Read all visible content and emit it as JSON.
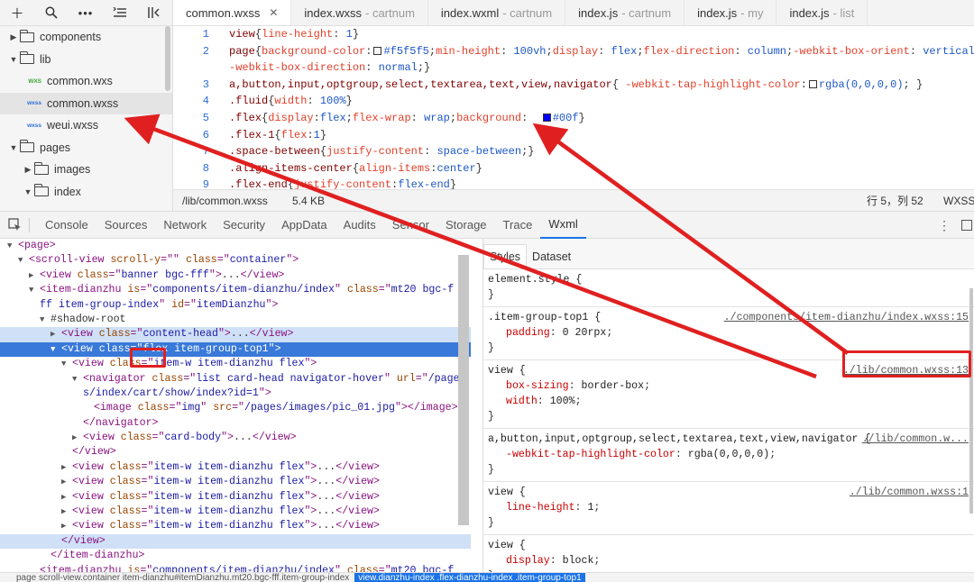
{
  "toolbar": {
    "buttons": [
      "plus-icon",
      "search-icon",
      "more-icon",
      "collapse-icon",
      "split-icon"
    ]
  },
  "sidebar": {
    "items": [
      {
        "label": "components",
        "type": "folder",
        "open": false,
        "indent": 0
      },
      {
        "label": "lib",
        "type": "folder",
        "open": true,
        "indent": 0
      },
      {
        "label": "common.wxs",
        "type": "wxs",
        "indent": 1,
        "badge": "WXS"
      },
      {
        "label": "common.wxss",
        "type": "wxss",
        "indent": 1,
        "badge": "wxss",
        "selected": true
      },
      {
        "label": "weui.wxss",
        "type": "wxss",
        "indent": 1,
        "badge": "wxss"
      },
      {
        "label": "pages",
        "type": "folder",
        "open": true,
        "indent": 0
      },
      {
        "label": "images",
        "type": "folder",
        "open": false,
        "indent": 1
      },
      {
        "label": "index",
        "type": "folder",
        "open": true,
        "indent": 1
      }
    ]
  },
  "editor": {
    "tabs": [
      {
        "name": "common.wxss",
        "dim": "",
        "active": true,
        "close": "✕"
      },
      {
        "name": "index.wxss",
        "dim": "- cartnum"
      },
      {
        "name": "index.wxml",
        "dim": "- cartnum"
      },
      {
        "name": "index.js",
        "dim": "- cartnum"
      },
      {
        "name": "index.js",
        "dim": "- my"
      },
      {
        "name": "index.js",
        "dim": "- list"
      }
    ],
    "lines": [
      {
        "n": "1",
        "t": [
          [
            "sel-c",
            "view"
          ],
          [
            "pun",
            "{"
          ],
          [
            "prop",
            "line-height"
          ],
          [
            "pun",
            ": "
          ],
          [
            "val",
            "1"
          ],
          [
            "pun",
            "}"
          ]
        ]
      },
      {
        "n": "2",
        "t": [
          [
            "sel-c",
            "page"
          ],
          [
            "pun",
            "{"
          ],
          [
            "prop",
            "background-color"
          ],
          [
            "pun",
            ":"
          ],
          [
            "sw",
            "#f5f5f5"
          ],
          [
            "val",
            "#f5f5f5"
          ],
          [
            "pun",
            ";"
          ],
          [
            "prop",
            "min-height"
          ],
          [
            "pun",
            ": "
          ],
          [
            "val",
            "100vh"
          ],
          [
            "pun",
            ";"
          ],
          [
            "prop",
            "display"
          ],
          [
            "pun",
            ": "
          ],
          [
            "val",
            "flex"
          ],
          [
            "pun",
            ";"
          ],
          [
            "prop",
            "flex-direction"
          ],
          [
            "pun",
            ": "
          ],
          [
            "val",
            "column"
          ],
          [
            "pun",
            ";"
          ],
          [
            "prop",
            "-webkit-box-orient"
          ],
          [
            "pun",
            ": "
          ],
          [
            "val",
            "vertical"
          ],
          [
            "pun",
            ";"
          ]
        ]
      },
      {
        "n": "",
        "t": [
          [
            "prop",
            "-webkit-box-direction"
          ],
          [
            "pun",
            ": "
          ],
          [
            "val",
            "normal"
          ],
          [
            "pun",
            ";}"
          ]
        ]
      },
      {
        "n": "3",
        "t": [
          [
            "sel-c",
            "a,button,input,optgroup,select,textarea,text,view,navigator"
          ],
          [
            "pun",
            "{ "
          ],
          [
            "prop",
            "-webkit-tap-highlight-color"
          ],
          [
            "pun",
            ":"
          ],
          [
            "sw",
            "#ffffff"
          ],
          [
            "val",
            "rgba(0,0,0,0)"
          ],
          [
            "pun",
            "; }"
          ]
        ]
      },
      {
        "n": "4",
        "t": [
          [
            "sel-c",
            ".fluid"
          ],
          [
            "pun",
            "{"
          ],
          [
            "prop",
            "width"
          ],
          [
            "pun",
            ": "
          ],
          [
            "val",
            "100%"
          ],
          [
            "pun",
            "}"
          ]
        ]
      },
      {
        "n": "5",
        "t": [
          [
            "sel-c",
            ".flex"
          ],
          [
            "pun",
            "{"
          ],
          [
            "prop",
            "display"
          ],
          [
            "pun",
            ":"
          ],
          [
            "val",
            "flex"
          ],
          [
            "pun",
            ";"
          ],
          [
            "prop",
            "flex-wrap"
          ],
          [
            "pun",
            ": "
          ],
          [
            "val",
            "wrap"
          ],
          [
            "pun",
            ";"
          ],
          [
            "prop",
            "background"
          ],
          [
            "pun",
            ":  "
          ],
          [
            "sw",
            "#0000ff"
          ],
          [
            "val",
            "#00f"
          ],
          [
            "pun",
            "}"
          ]
        ]
      },
      {
        "n": "6",
        "t": [
          [
            "sel-c",
            ".flex-1"
          ],
          [
            "pun",
            "{"
          ],
          [
            "prop",
            "flex"
          ],
          [
            "pun",
            ":"
          ],
          [
            "val",
            "1"
          ],
          [
            "pun",
            "}"
          ]
        ]
      },
      {
        "n": "7",
        "t": [
          [
            "sel-c",
            ".space-between"
          ],
          [
            "pun",
            "{"
          ],
          [
            "prop",
            "justify-content"
          ],
          [
            "pun",
            ": "
          ],
          [
            "val",
            "space-between"
          ],
          [
            "pun",
            ";}"
          ]
        ]
      },
      {
        "n": "8",
        "t": [
          [
            "sel-c",
            ".align-items-center"
          ],
          [
            "pun",
            "{"
          ],
          [
            "prop",
            "align-items"
          ],
          [
            "pun",
            ":"
          ],
          [
            "val",
            "center"
          ],
          [
            "pun",
            "}"
          ]
        ]
      },
      {
        "n": "9",
        "t": [
          [
            "sel-c",
            ".flex-end"
          ],
          [
            "pun",
            "{"
          ],
          [
            "prop",
            "justify-content"
          ],
          [
            "pun",
            ":"
          ],
          [
            "val",
            "flex-end"
          ],
          [
            "pun",
            "}"
          ]
        ]
      }
    ],
    "status": {
      "path": "/lib/common.wxss",
      "size": "5.4 KB",
      "cursor": "行 5，列 52",
      "lang": "WXSS"
    }
  },
  "devtools": {
    "tabs": [
      "Console",
      "Sources",
      "Network",
      "Security",
      "AppData",
      "Audits",
      "Sensor",
      "Storage",
      "Trace",
      "Wxml"
    ],
    "active": "Wxml"
  },
  "elements": [
    {
      "ind": 0,
      "tri": "▼",
      "p": [
        [
          "t",
          "<page>"
        ]
      ]
    },
    {
      "ind": 1,
      "tri": "▼",
      "p": [
        [
          "t",
          "<scroll-view "
        ],
        [
          "a",
          "scroll-y"
        ],
        [
          "t",
          "=\""
        ],
        [
          "v",
          ""
        ],
        [
          "t",
          "\" "
        ],
        [
          "a",
          "class"
        ],
        [
          "t",
          "=\""
        ],
        [
          "v",
          "container"
        ],
        [
          "t",
          "\">"
        ]
      ]
    },
    {
      "ind": 2,
      "tri": "▶",
      "p": [
        [
          "t",
          "<view "
        ],
        [
          "a",
          "class"
        ],
        [
          "t",
          "=\""
        ],
        [
          "v",
          "banner bgc-fff"
        ],
        [
          "t",
          "\">"
        ],
        [
          "x",
          "..."
        ],
        [
          "t",
          "</view>"
        ]
      ]
    },
    {
      "ind": 2,
      "tri": "▼",
      "p": [
        [
          "t",
          "<item-dianzhu "
        ],
        [
          "a",
          "is"
        ],
        [
          "t",
          "=\""
        ],
        [
          "v",
          "components/item-dianzhu/index"
        ],
        [
          "t",
          "\" "
        ],
        [
          "a",
          "class"
        ],
        [
          "t",
          "=\""
        ],
        [
          "v",
          "mt20 bgc-f"
        ]
      ]
    },
    {
      "ind": 2,
      "tri": "",
      "p": [
        [
          "v",
          "ff item-group-index"
        ],
        [
          "t",
          "\" "
        ],
        [
          "a",
          "id"
        ],
        [
          "t",
          "=\""
        ],
        [
          "v",
          "itemDianzhu"
        ],
        [
          "t",
          "\">"
        ]
      ]
    },
    {
      "ind": 3,
      "tri": "▼",
      "p": [
        [
          "x",
          "#shadow-root"
        ]
      ]
    },
    {
      "ind": 4,
      "tri": "▶",
      "p": [
        [
          "t",
          "<view "
        ],
        [
          "a",
          "class"
        ],
        [
          "t",
          "=\""
        ],
        [
          "v",
          "content-head"
        ],
        [
          "t",
          "\">"
        ],
        [
          "x",
          "..."
        ],
        [
          "t",
          "</view>"
        ]
      ],
      "sel": true
    },
    {
      "ind": 4,
      "tri": "▼",
      "p": [
        [
          "t",
          "<view "
        ],
        [
          "a",
          "class"
        ],
        [
          "t",
          "=\""
        ],
        [
          "v",
          "flex item-group-top1"
        ],
        [
          "t",
          "\">"
        ]
      ],
      "hl": true
    },
    {
      "ind": 5,
      "tri": "▼",
      "p": [
        [
          "t",
          "<view "
        ],
        [
          "a",
          "class"
        ],
        [
          "t",
          "=\""
        ],
        [
          "v",
          "item-w item-dianzhu flex"
        ],
        [
          "t",
          "\">"
        ]
      ]
    },
    {
      "ind": 6,
      "tri": "▼",
      "p": [
        [
          "t",
          "<navigator "
        ],
        [
          "a",
          "class"
        ],
        [
          "t",
          "=\""
        ],
        [
          "v",
          "list card-head navigator-hover"
        ],
        [
          "t",
          "\" "
        ],
        [
          "a",
          "url"
        ],
        [
          "t",
          "=\""
        ],
        [
          "v",
          "/page"
        ]
      ]
    },
    {
      "ind": 6,
      "tri": "",
      "p": [
        [
          "v",
          "s/index/cart/show/index?id=1"
        ],
        [
          "t",
          "\">"
        ]
      ]
    },
    {
      "ind": 7,
      "tri": "",
      "p": [
        [
          "t",
          "<image "
        ],
        [
          "a",
          "class"
        ],
        [
          "t",
          "=\""
        ],
        [
          "v",
          "img"
        ],
        [
          "t",
          "\" "
        ],
        [
          "a",
          "src"
        ],
        [
          "t",
          "=\""
        ],
        [
          "v",
          "/pages/images/pic_01.jpg"
        ],
        [
          "t",
          "\"></image>"
        ]
      ]
    },
    {
      "ind": 6,
      "tri": "",
      "p": [
        [
          "t",
          "</navigator>"
        ]
      ]
    },
    {
      "ind": 6,
      "tri": "▶",
      "p": [
        [
          "t",
          "<view "
        ],
        [
          "a",
          "class"
        ],
        [
          "t",
          "=\""
        ],
        [
          "v",
          "card-body"
        ],
        [
          "t",
          "\">"
        ],
        [
          "x",
          "..."
        ],
        [
          "t",
          "</view>"
        ]
      ]
    },
    {
      "ind": 5,
      "tri": "",
      "p": [
        [
          "t",
          "</view>"
        ]
      ]
    },
    {
      "ind": 5,
      "tri": "▶",
      "p": [
        [
          "t",
          "<view "
        ],
        [
          "a",
          "class"
        ],
        [
          "t",
          "=\""
        ],
        [
          "v",
          "item-w item-dianzhu flex"
        ],
        [
          "t",
          "\">"
        ],
        [
          "x",
          "..."
        ],
        [
          "t",
          "</view>"
        ]
      ]
    },
    {
      "ind": 5,
      "tri": "▶",
      "p": [
        [
          "t",
          "<view "
        ],
        [
          "a",
          "class"
        ],
        [
          "t",
          "=\""
        ],
        [
          "v",
          "item-w item-dianzhu flex"
        ],
        [
          "t",
          "\">"
        ],
        [
          "x",
          "..."
        ],
        [
          "t",
          "</view>"
        ]
      ]
    },
    {
      "ind": 5,
      "tri": "▶",
      "p": [
        [
          "t",
          "<view "
        ],
        [
          "a",
          "class"
        ],
        [
          "t",
          "=\""
        ],
        [
          "v",
          "item-w item-dianzhu flex"
        ],
        [
          "t",
          "\">"
        ],
        [
          "x",
          "..."
        ],
        [
          "t",
          "</view>"
        ]
      ]
    },
    {
      "ind": 5,
      "tri": "▶",
      "p": [
        [
          "t",
          "<view "
        ],
        [
          "a",
          "class"
        ],
        [
          "t",
          "=\""
        ],
        [
          "v",
          "item-w item-dianzhu flex"
        ],
        [
          "t",
          "\">"
        ],
        [
          "x",
          "..."
        ],
        [
          "t",
          "</view>"
        ]
      ]
    },
    {
      "ind": 5,
      "tri": "▶",
      "p": [
        [
          "t",
          "<view "
        ],
        [
          "a",
          "class"
        ],
        [
          "t",
          "=\""
        ],
        [
          "v",
          "item-w item-dianzhu flex"
        ],
        [
          "t",
          "\">"
        ],
        [
          "x",
          "..."
        ],
        [
          "t",
          "</view>"
        ]
      ]
    },
    {
      "ind": 4,
      "tri": "",
      "p": [
        [
          "t",
          "</view>"
        ]
      ],
      "sel": true
    },
    {
      "ind": 3,
      "tri": "",
      "p": [
        [
          "t",
          "</item-dianzhu>"
        ]
      ]
    },
    {
      "ind": 2,
      "tri": "",
      "p": [
        [
          "t",
          "<item-dianzhu "
        ],
        [
          "a",
          "is"
        ],
        [
          "t",
          "=\""
        ],
        [
          "v",
          "components/item-dianzhu/index"
        ],
        [
          "t",
          "\" "
        ],
        [
          "a",
          "class"
        ],
        [
          "t",
          "=\""
        ],
        [
          "v",
          "mt20 bgc-f"
        ]
      ]
    }
  ],
  "breadcrumbs": {
    "text": "page  scroll-view.container  item-dianzhu#itemDianzhu.mt20.bgc-fff.item-group-index",
    "selected": "view.dianzhu-index .flex-dianzhu-index .item-group-top1"
  },
  "styles": {
    "tabs": [
      "Styles",
      "Dataset"
    ],
    "rules": [
      {
        "selector": "element.style {",
        "src": "",
        "decls": [],
        "close": "}"
      },
      {
        "selector": ".item-group-top1 {",
        "src": "./components/item-dianzhu/index.wxss:15",
        "decls": [
          [
            "padding",
            "0 20rpx"
          ]
        ],
        "close": "}"
      },
      {
        "selector": "view {",
        "src": "./lib/common.wxss:13",
        "decls": [
          [
            "box-sizing",
            "border-box"
          ],
          [
            "width",
            "100%"
          ]
        ],
        "close": "}"
      },
      {
        "selector": "a,button,input,optgroup,select,textarea,text,view,navigator {",
        "src": "./lib/common.w...",
        "decls": [
          [
            "-webkit-tap-highlight-color",
            "rgba(0,0,0,0)"
          ]
        ],
        "close": "}"
      },
      {
        "selector": "view {",
        "src": "./lib/common.wxss:1",
        "decls": [
          [
            "line-height",
            "1"
          ]
        ],
        "close": "}"
      },
      {
        "selector": "view {",
        "src": "",
        "decls": [
          [
            "display",
            "block"
          ]
        ],
        "close": "}"
      }
    ]
  },
  "colors": {
    "accent": "#1a73e8",
    "annotation": "#e02020",
    "highlight_row": "#3879d9"
  }
}
